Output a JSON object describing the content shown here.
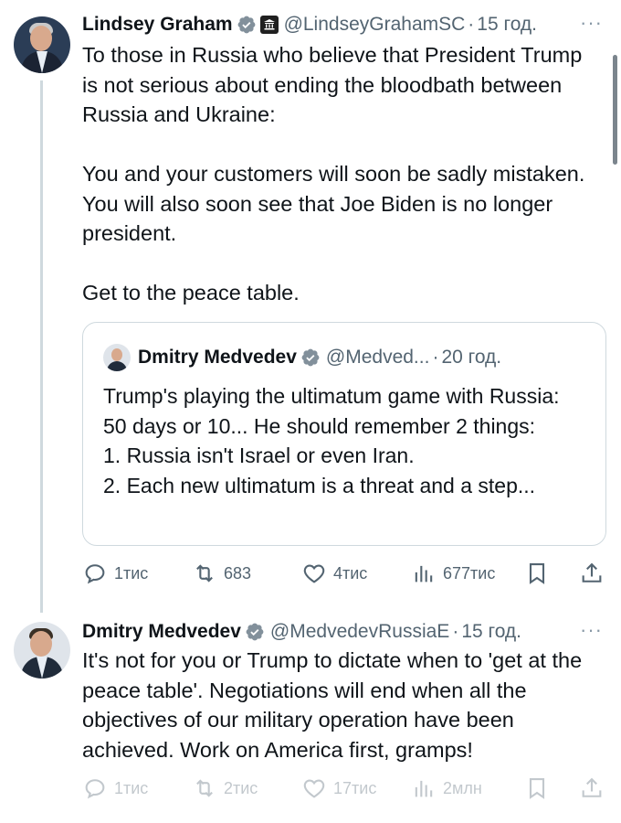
{
  "tweet1": {
    "name": "Lindsey Graham",
    "handle": "@LindseyGrahamSC",
    "dot": "·",
    "time": "15 год.",
    "more": "···",
    "text": "To those in Russia who believe that President Trump is not serious about ending the bloodbath between Russia and Ukraine:\n\nYou and your customers will soon be sadly mistaken. You will also soon see that Joe Biden is no longer president.\n\nGet to the peace table.",
    "quote": {
      "name": "Dmitry Medvedev",
      "handle": "@Medved...",
      "dot": "·",
      "time": "20 год.",
      "text": "Trump's playing the ultimatum game with Russia: 50 days or 10... He should remember 2 things:\n1. Russia isn't Israel or even Iran.\n2. Each new ultimatum is a threat and a step..."
    },
    "actions": {
      "replies": "1тис",
      "reposts": "683",
      "likes": "4тис",
      "views": "677тис"
    }
  },
  "tweet2": {
    "name": "Dmitry Medvedev",
    "handle": "@MedvedevRussiaE",
    "dot": "·",
    "time": "15 год.",
    "more": "···",
    "text": "It's not for you or Trump to dictate when to 'get at the peace table'. Negotiations will end when all the objectives of our military operation have been achieved. Work on America first, gramps!",
    "actions": {
      "replies": "1тис",
      "reposts": "2тис",
      "likes": "17тис",
      "views": "2млн"
    }
  },
  "colors": {
    "verified": "#1d9bf0",
    "secondary_text": "#536471",
    "border": "#cfd9de"
  }
}
